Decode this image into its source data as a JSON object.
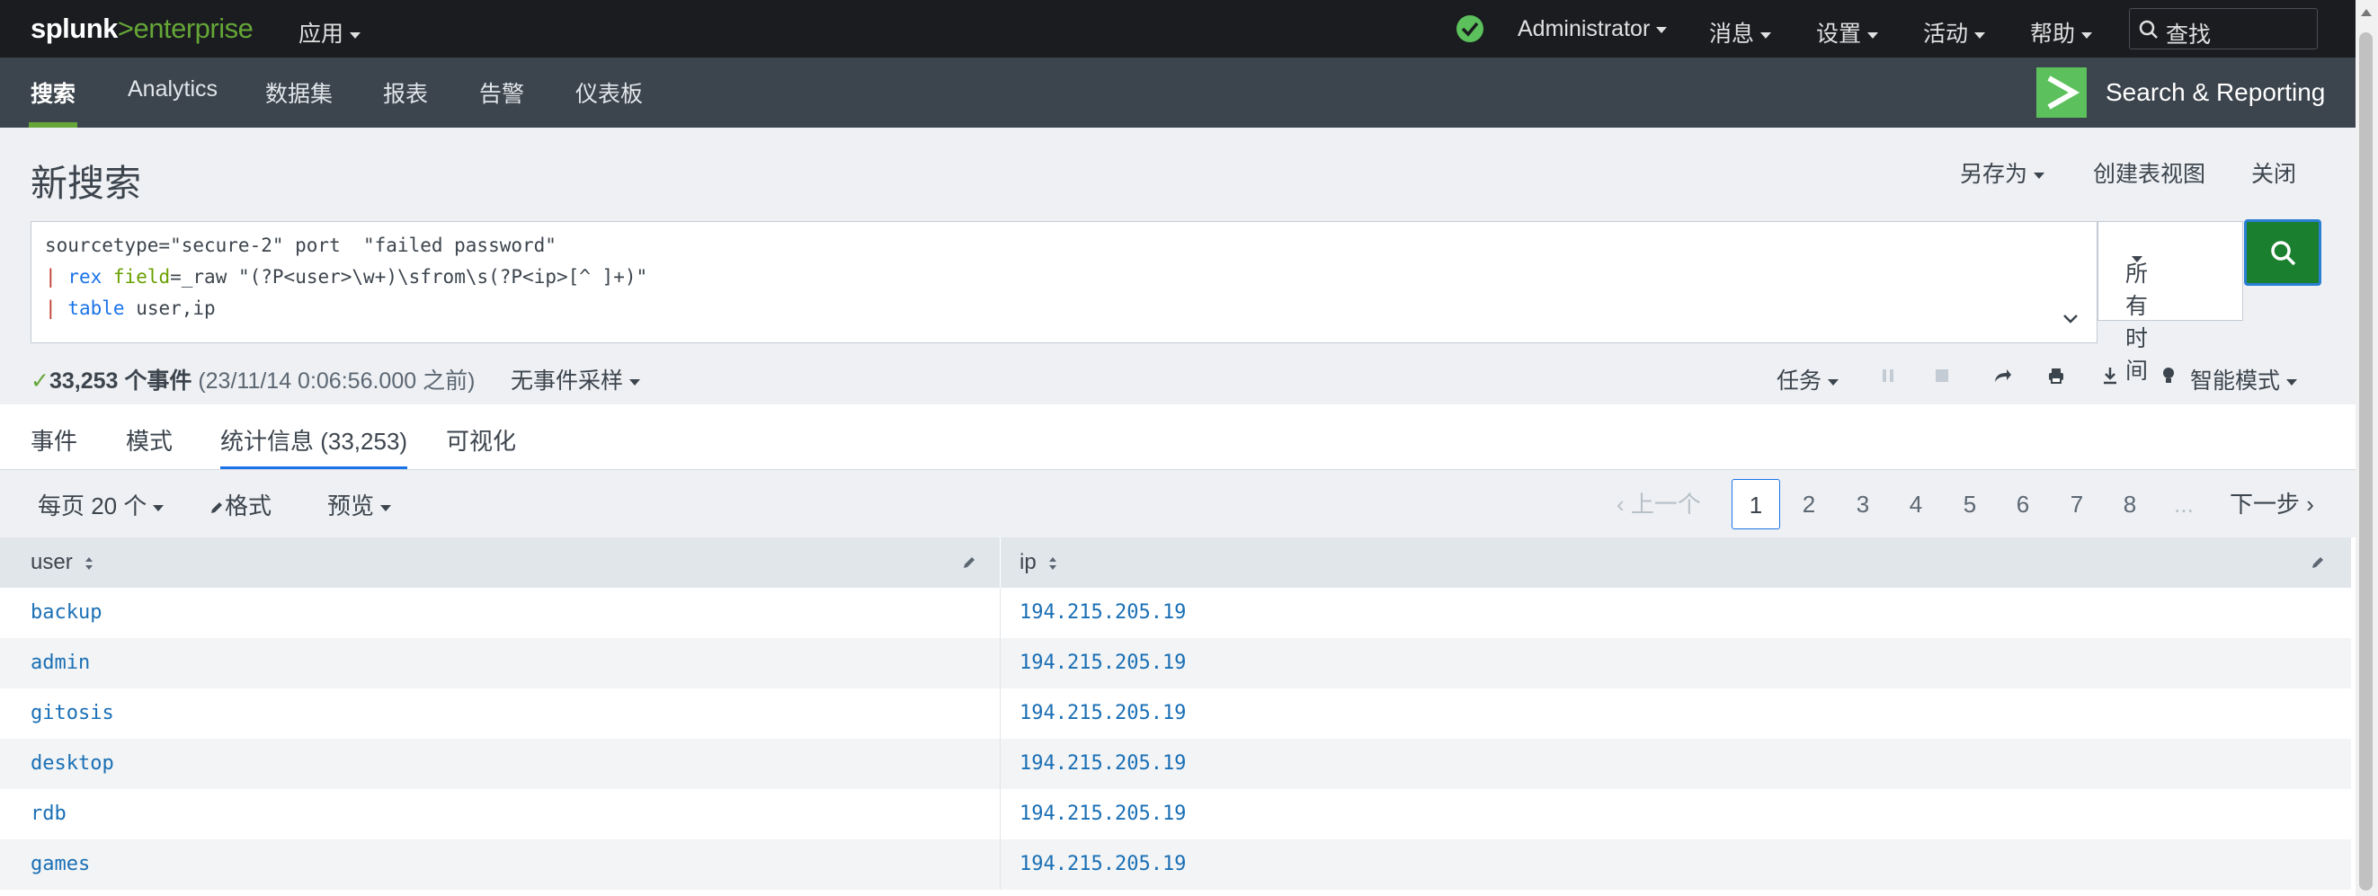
{
  "topbar": {
    "logo_main": "splunk",
    "logo_gt": ">",
    "logo_sub": "enterprise",
    "apps_menu": "应用",
    "user_menu": "Administrator",
    "messages_menu": "消息",
    "settings_menu": "设置",
    "activity_menu": "活动",
    "help_menu": "帮助",
    "search_placeholder": "查找"
  },
  "appbar": {
    "tabs": [
      {
        "label": "搜索",
        "active": true
      },
      {
        "label": "Analytics"
      },
      {
        "label": "数据集"
      },
      {
        "label": "报表"
      },
      {
        "label": "告警"
      },
      {
        "label": "仪表板"
      }
    ],
    "app_name": "Search & Reporting"
  },
  "header": {
    "title": "新搜索",
    "save_as": "另存为",
    "create_table_view": "创建表视图",
    "close": "关闭"
  },
  "search": {
    "line1": "sourcetype=\"secure-2\" port  \"failed password\"",
    "line2_pipe": "|",
    "line2_cmd": "rex",
    "line2_field": "field",
    "line2_rest": "=_raw \"(?P<user>\\w+)\\sfrom\\s(?P<ip>[^ ]+)\"",
    "line3_pipe": "|",
    "line3_cmd": "table",
    "line3_rest": "user,ip",
    "time_range": "所有时间"
  },
  "job": {
    "check": "✓",
    "event_count": "33,253 个事件",
    "time_note": "(23/11/14 0:06:56.000 之前)",
    "sampling": "无事件采样",
    "jobs_menu": "任务",
    "mode": "智能模式"
  },
  "results_tabs": [
    {
      "label": "事件"
    },
    {
      "label": "模式"
    },
    {
      "label": "统计信息 (33,253)",
      "active": true
    },
    {
      "label": "可视化"
    }
  ],
  "controls": {
    "per_page": "每页 20 个",
    "format": "格式",
    "preview": "预览",
    "prev": "上一个",
    "pages": [
      "1",
      "2",
      "3",
      "4",
      "5",
      "6",
      "7",
      "8"
    ],
    "ellipsis": "...",
    "next": "下一步"
  },
  "table": {
    "columns": [
      "user",
      "ip"
    ],
    "rows": [
      {
        "user": "backup",
        "ip": "194.215.205.19"
      },
      {
        "user": "admin",
        "ip": "194.215.205.19"
      },
      {
        "user": "gitosis",
        "ip": "194.215.205.19"
      },
      {
        "user": "desktop",
        "ip": "194.215.205.19"
      },
      {
        "user": "rdb",
        "ip": "194.215.205.19"
      },
      {
        "user": "games",
        "ip": "194.215.205.19"
      }
    ]
  },
  "colors": {
    "brand_green": "#65a637",
    "search_button": "#1a7f2e",
    "link_blue": "#1a6fb5",
    "appbar_bg": "#3c444d"
  }
}
